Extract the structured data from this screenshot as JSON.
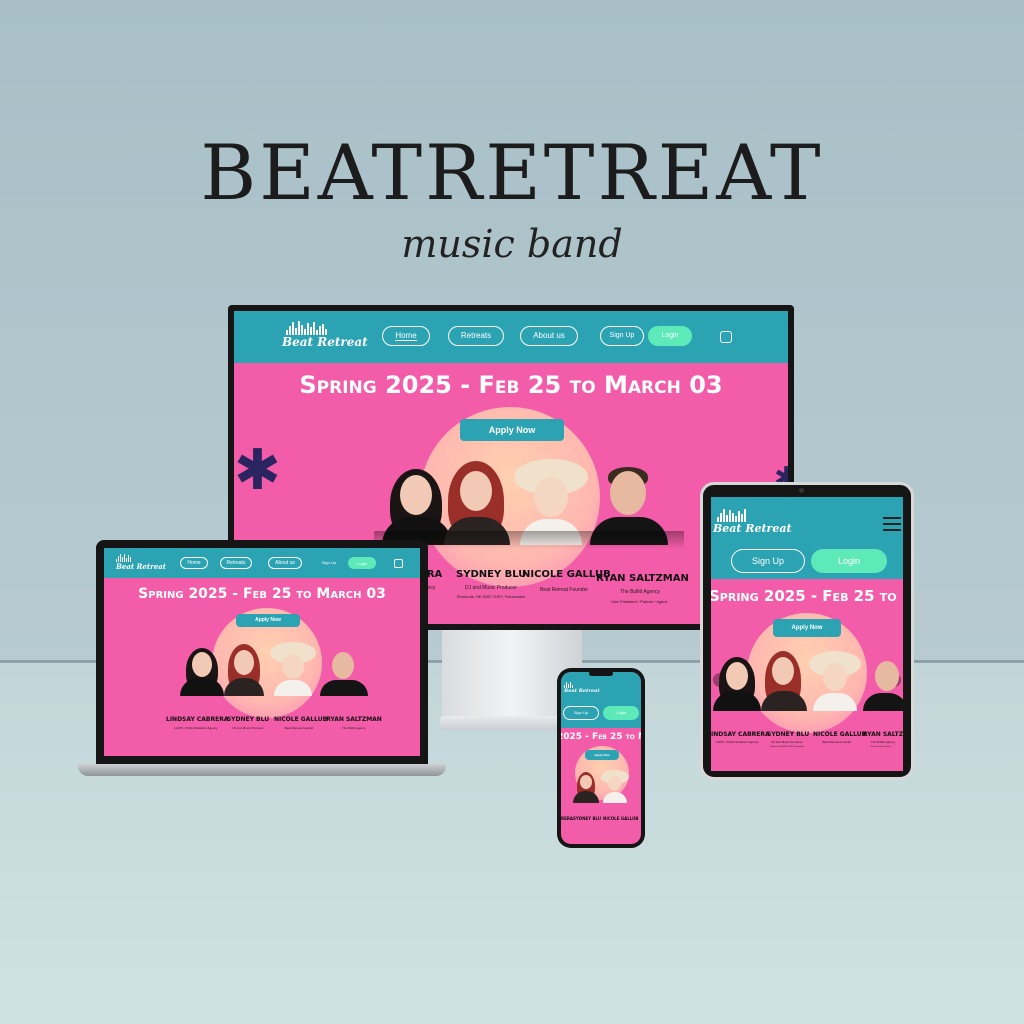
{
  "brand": {
    "title": "BEATRETREAT",
    "subtitle": "music band"
  },
  "site": {
    "logo": "Beat Retreat",
    "nav": {
      "home": "Home",
      "retreats": "Retreats",
      "about": "About us",
      "signup": "Sign Up",
      "login": "Login"
    },
    "hero": {
      "title": "Spring 2025 -  Feb 25 to March 03",
      "cta": "Apply Now"
    },
    "tablet_hero_title": "Spring 2025 - Feb 25 to March",
    "phone_hero_title": "2025 - Feb 25 to M",
    "people": [
      {
        "name": "Lindsay Cabrera",
        "role": "LGPR - Public Relations Agency"
      },
      {
        "name": "Sydney Blu",
        "role": "DJ and Music Producer"
      },
      {
        "name": "Nicole Gallub",
        "role": "Beat Retreat Founder"
      },
      {
        "name": "Ryan Saltzman",
        "role": "The Bullitt Agency"
      }
    ],
    "desktop_labels": {
      "p1_name": "ERA",
      "p1_role": "gency",
      "p2_role2": "Shortcuts, HE-SHE-THEY, Futurmaker",
      "p4_role": "Vice President / Partner / Agent"
    },
    "phone_labels": {
      "p1": "RERA",
      "p2": "SYDNEY BLU",
      "p3": "NICOLE GALLUB"
    },
    "tablet_labels": {
      "p1": "INDSAY CABRERA",
      "p4": "RYAN SALTZ",
      "p4_role": "Vice President / Partne"
    }
  },
  "colors": {
    "nav": "#2ba3b3",
    "hero": "#f35ca8",
    "login": "#5ee9b8"
  }
}
